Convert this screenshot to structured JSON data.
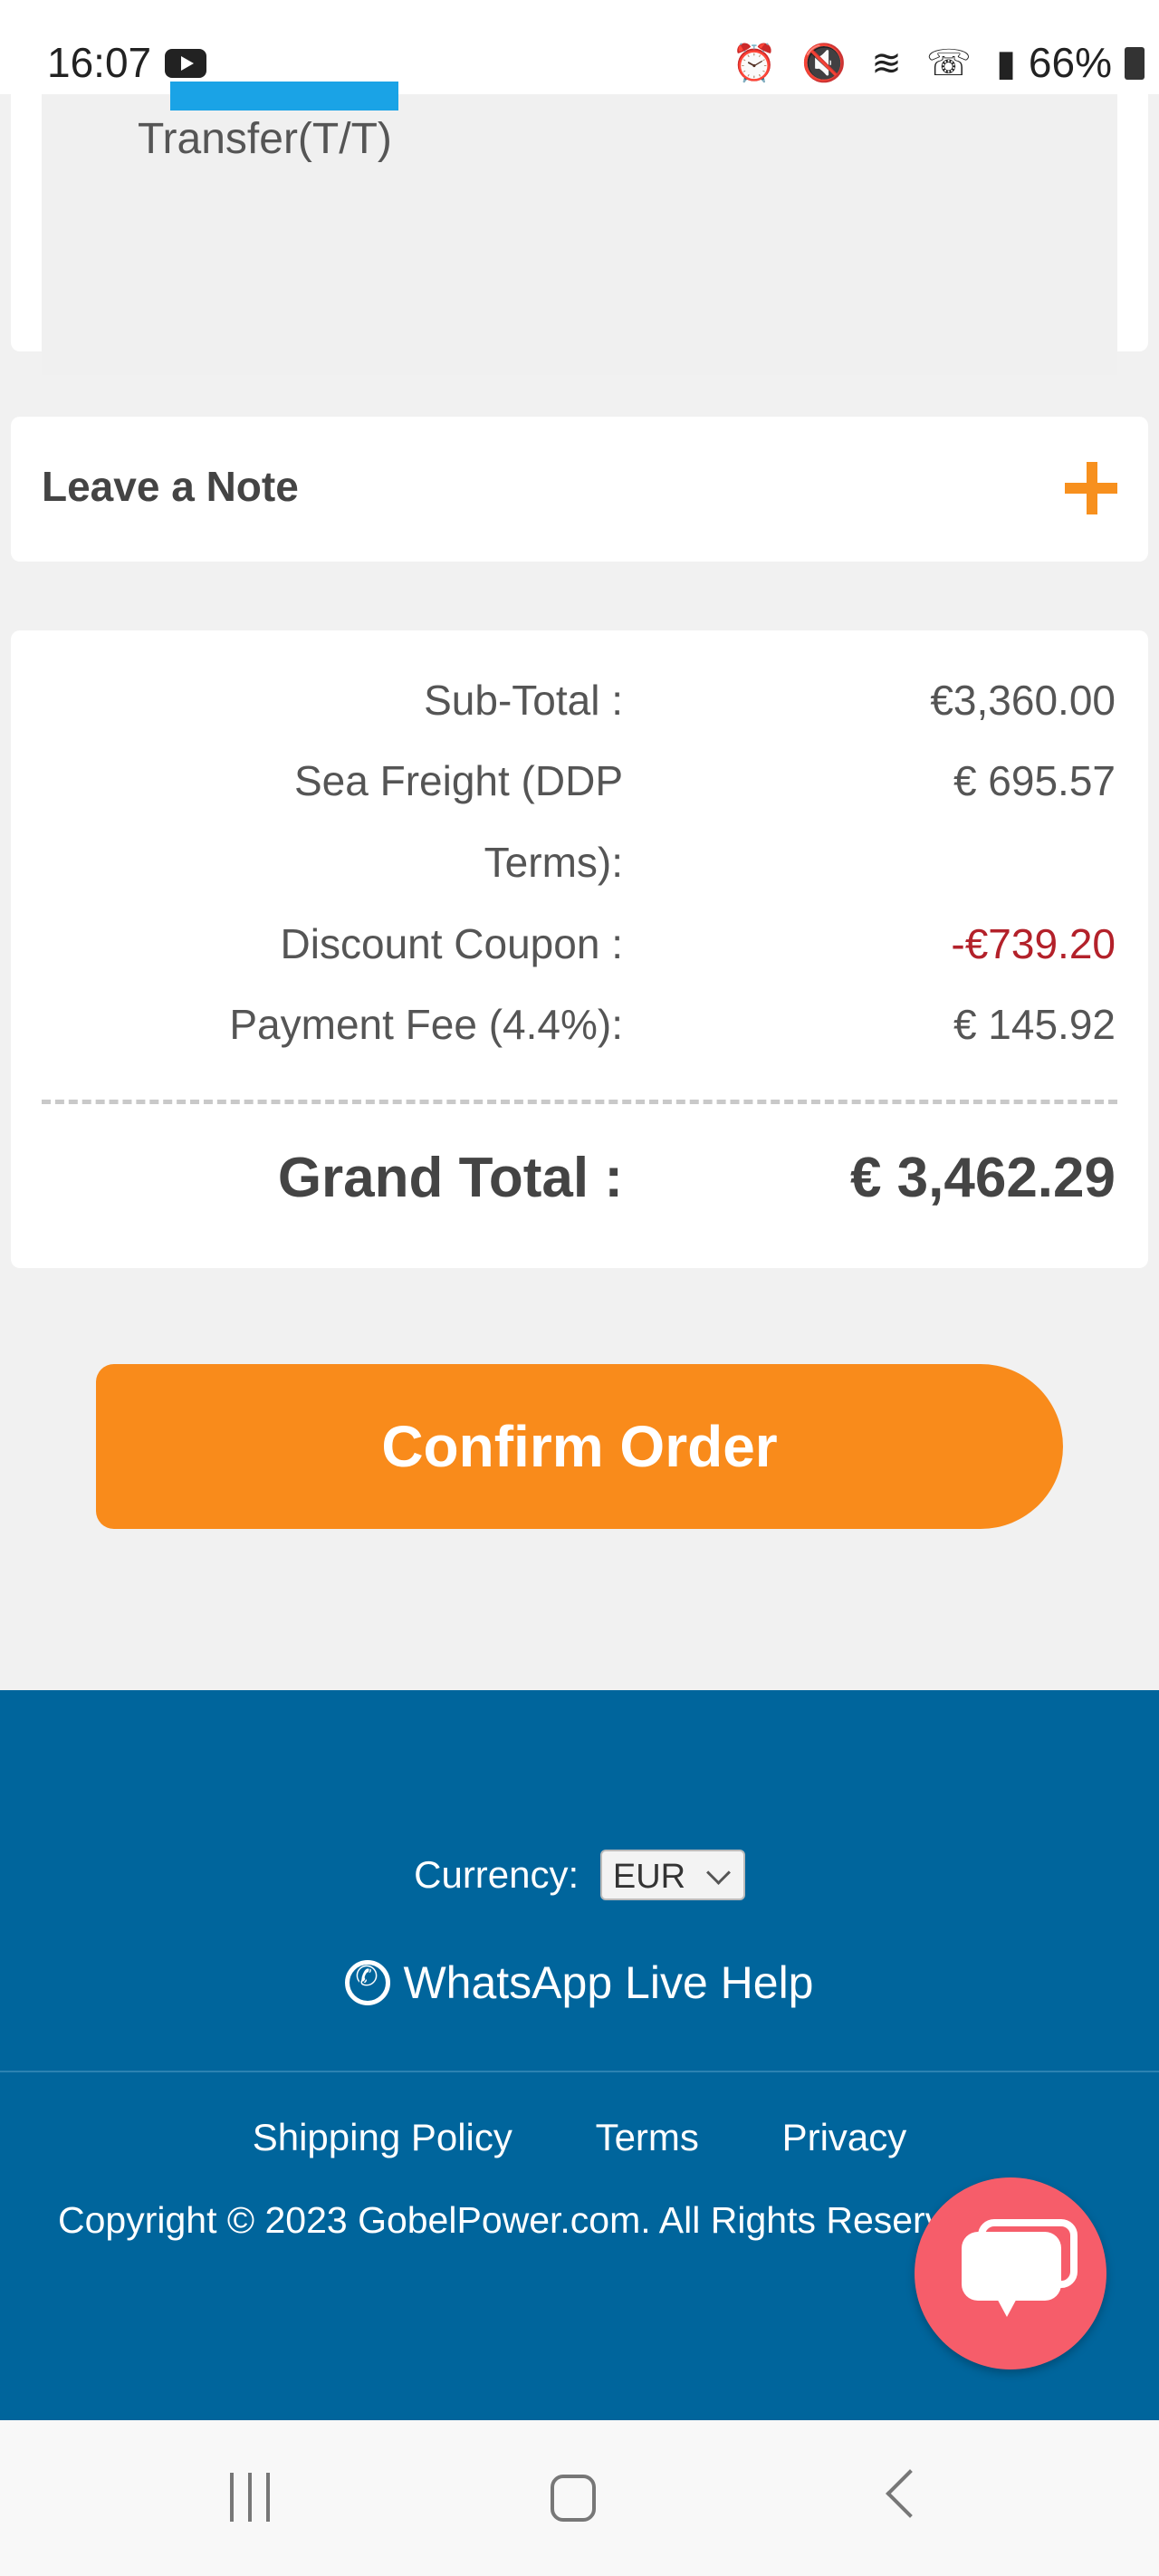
{
  "status_bar": {
    "time": "16:07",
    "battery": "66%"
  },
  "payment": {
    "method_text": "Transfer(T/T)"
  },
  "note": {
    "label": "Leave a Note"
  },
  "totals": {
    "rows": [
      {
        "label": "Sub-Total :",
        "value": "€3,360.00"
      },
      {
        "label": "Sea Freight (DDP",
        "label2": "Terms):",
        "value": "€ 695.57"
      },
      {
        "label": "Discount Coupon :",
        "value": "-€739.20"
      },
      {
        "label": "Payment Fee (4.4%):",
        "value": "€ 145.92"
      }
    ],
    "grand_label": "Grand Total :",
    "grand_value": "€ 3,462.29"
  },
  "actions": {
    "confirm_label": "Confirm Order"
  },
  "footer": {
    "currency_label": "Currency:",
    "currency_value": "EUR",
    "whatsapp_label": "WhatsApp Live Help",
    "links": [
      "Shipping Policy",
      "Terms",
      "Privacy"
    ],
    "copyright": "Copyright © 2023 GobelPower.com. All Rights Reserved"
  },
  "colors": {
    "accent": "#f98b1b",
    "footer_bg": "#00659c",
    "discount": "#b3212a",
    "chat": "#f65d6a"
  }
}
